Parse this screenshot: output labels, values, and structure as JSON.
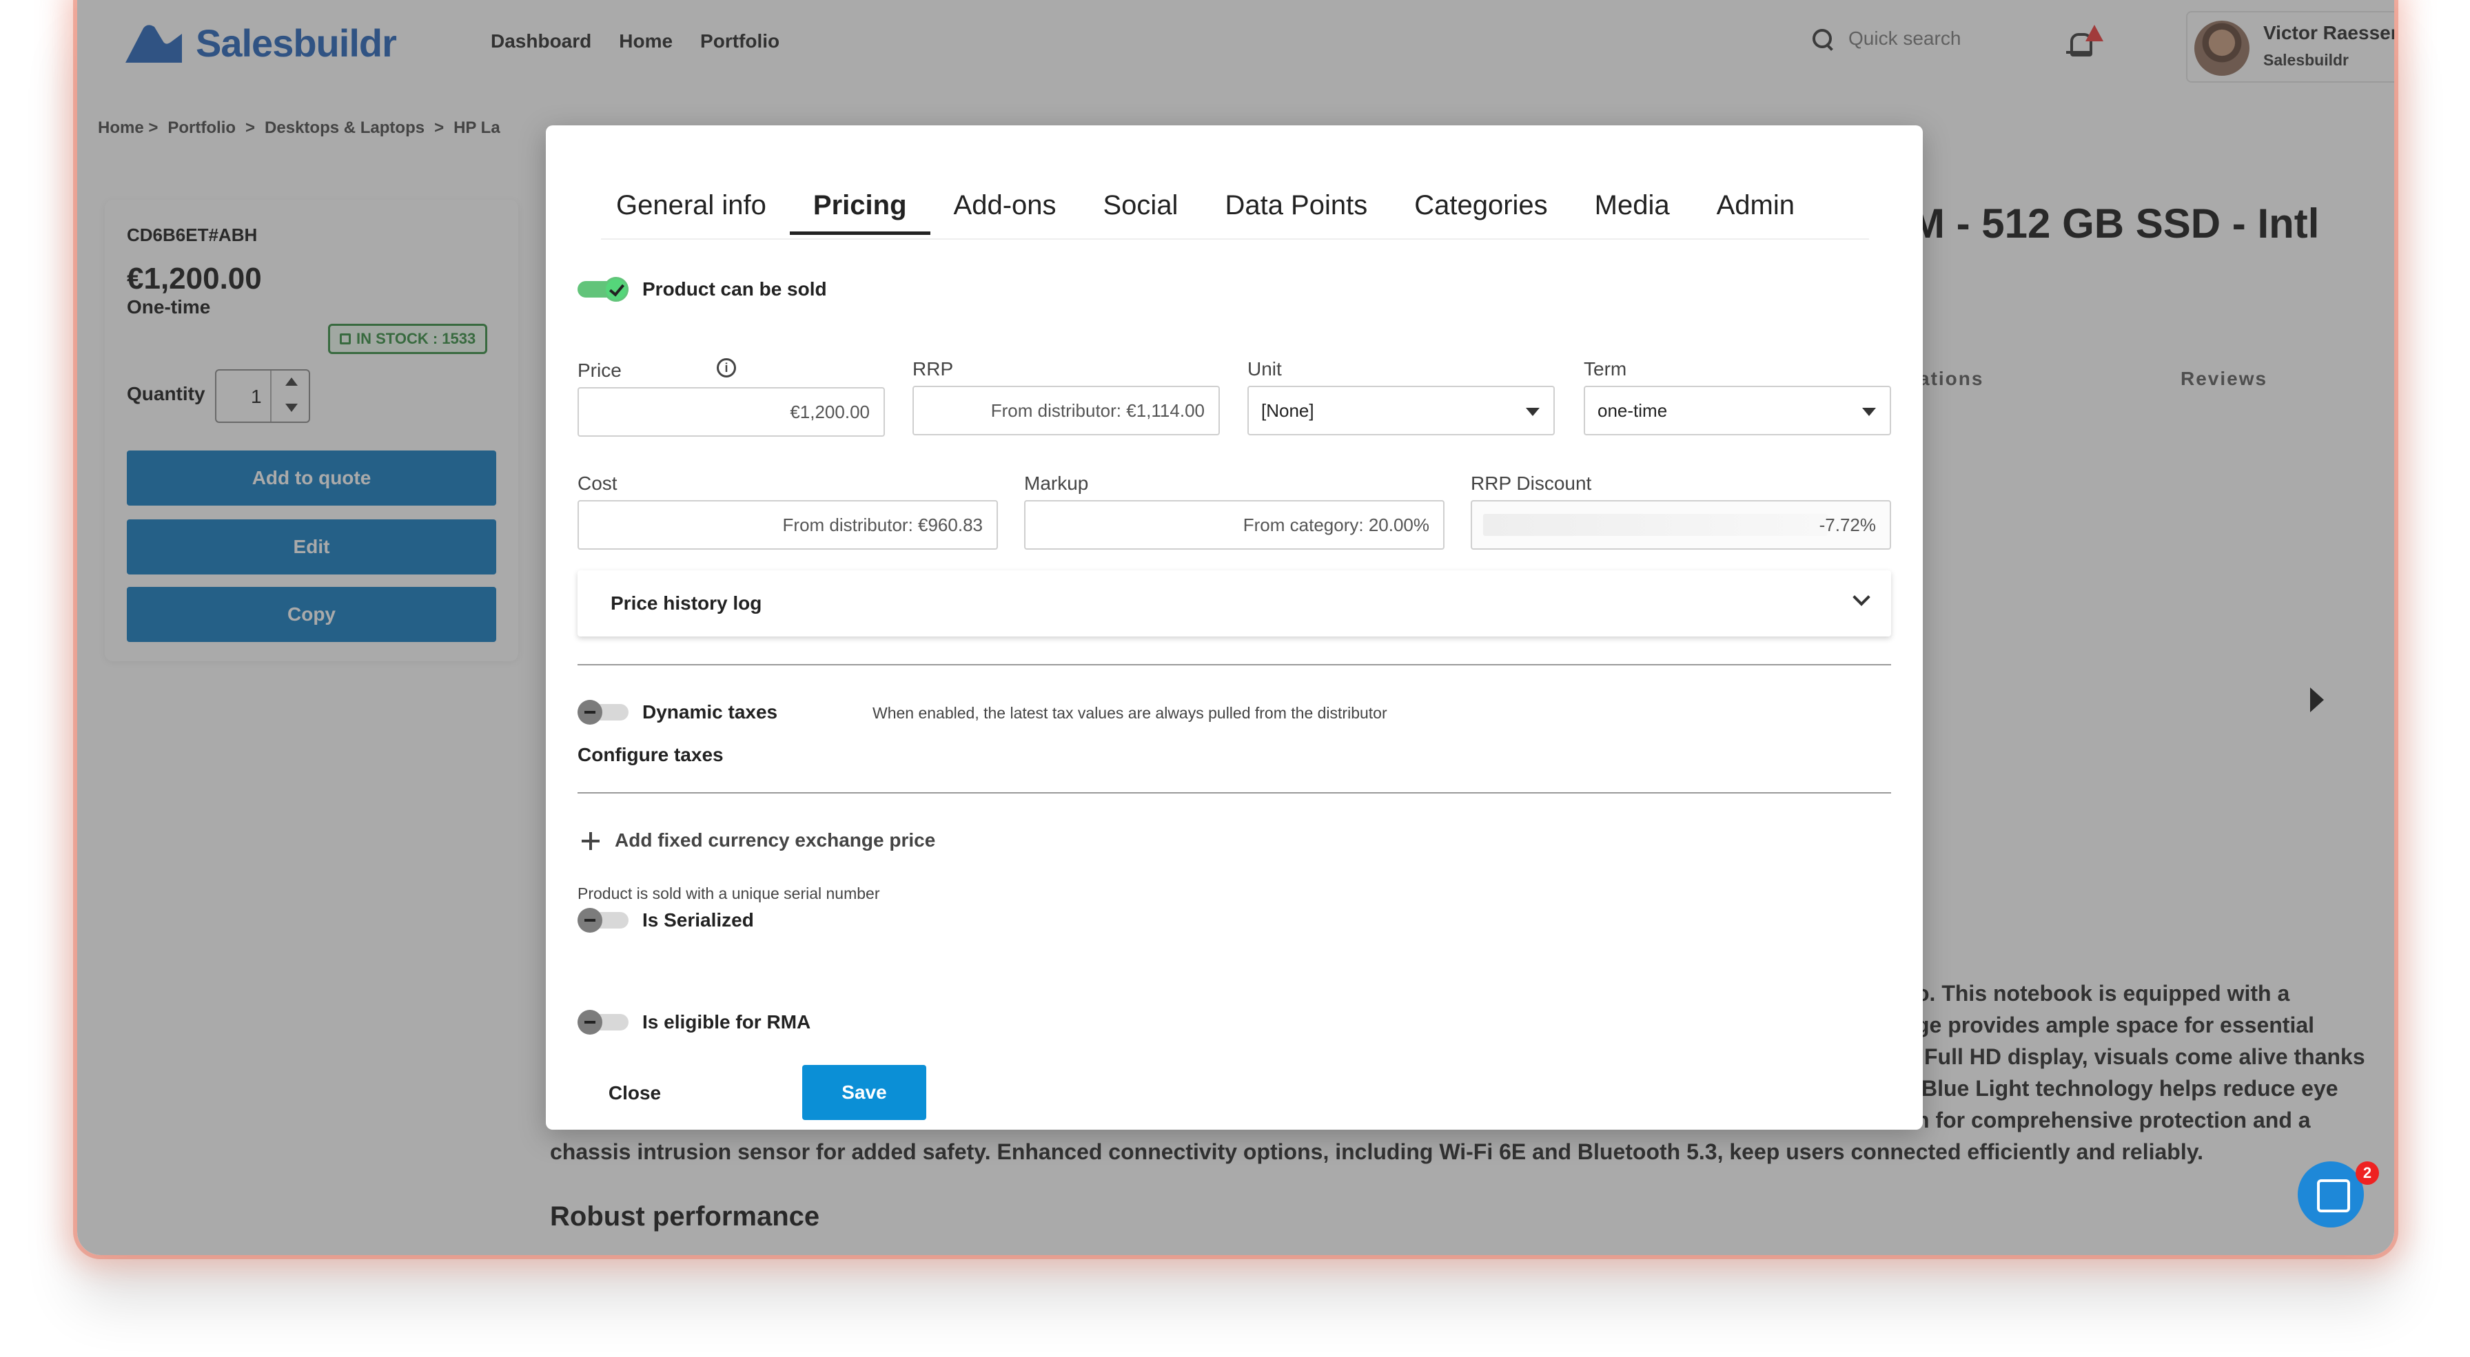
{
  "app": {
    "logo_text": "Salesbuildr",
    "nav": [
      "Dashboard",
      "Home",
      "Portfolio"
    ],
    "search_placeholder": "Quick search",
    "user": {
      "name": "Victor Raessen",
      "company": "Salesbuildr"
    }
  },
  "breadcrumb": [
    "Home >",
    "Portfolio",
    ">",
    "Desktops & Laptops",
    ">",
    "HP La"
  ],
  "product_card": {
    "sku": "CD6B6ET#ABH",
    "price": "€1,200.00",
    "billing": "One-time",
    "stock": "IN STOCK : 1533",
    "quantity_label": "Quantity",
    "quantity": "1",
    "buttons": [
      "Add to quote",
      "Edit",
      "Copy"
    ]
  },
  "background": {
    "title_fragment": "M - 512 GB SSD - Intl",
    "tab_fragment": "ations",
    "tab_reviews": "Reviews",
    "para_fragments": [
      "o. This notebook is equipped with a",
      "ge provides ample space for essential",
      "Full HD display, visuals come alive thanks",
      "Blue Light technology helps reduce eye",
      "n for comprehensive protection and a"
    ],
    "para_full_line": "chassis intrusion sensor for added safety. Enhanced connectivity options, including Wi-Fi 6E and Bluetooth 5.3, keep users connected efficiently and reliably.",
    "heading": "Robust performance",
    "chat_badge": "2"
  },
  "modal": {
    "tabs": [
      "General info",
      "Pricing",
      "Add-ons",
      "Social",
      "Data Points",
      "Categories",
      "Media",
      "Admin"
    ],
    "active_tab": "Pricing",
    "can_be_sold_label": "Product can be sold",
    "price_label": "Price",
    "price_value": "€1,200.00",
    "rrp_label": "RRP",
    "rrp_value": "From distributor: €1,114.00",
    "unit_label": "Unit",
    "unit_value": "[None]",
    "term_label": "Term",
    "term_value": "one-time",
    "cost_label": "Cost",
    "cost_value": "From distributor: €960.83",
    "markup_label": "Markup",
    "markup_value": "From category: 20.00%",
    "rrp_discount_label": "RRP Discount",
    "rrp_discount_value": "-7.72%",
    "price_history_label": "Price history log",
    "dynamic_taxes_label": "Dynamic taxes",
    "dynamic_taxes_hint": "When enabled, the latest tax values are always pulled from the distributor",
    "configure_taxes_label": "Configure taxes",
    "add_currency_label": "Add fixed currency exchange price",
    "serial_hint": "Product is sold with a unique serial number",
    "serialized_label": "Is Serialized",
    "rma_label": "Is eligible for RMA",
    "close_label": "Close",
    "save_label": "Save"
  },
  "colors": {
    "brand_blue": "#1f5fb8",
    "button_blue": "#0b77bf",
    "save_blue": "#0b8fd6",
    "toggle_on": "#62c47a",
    "stock_green": "#2d8a3a"
  }
}
